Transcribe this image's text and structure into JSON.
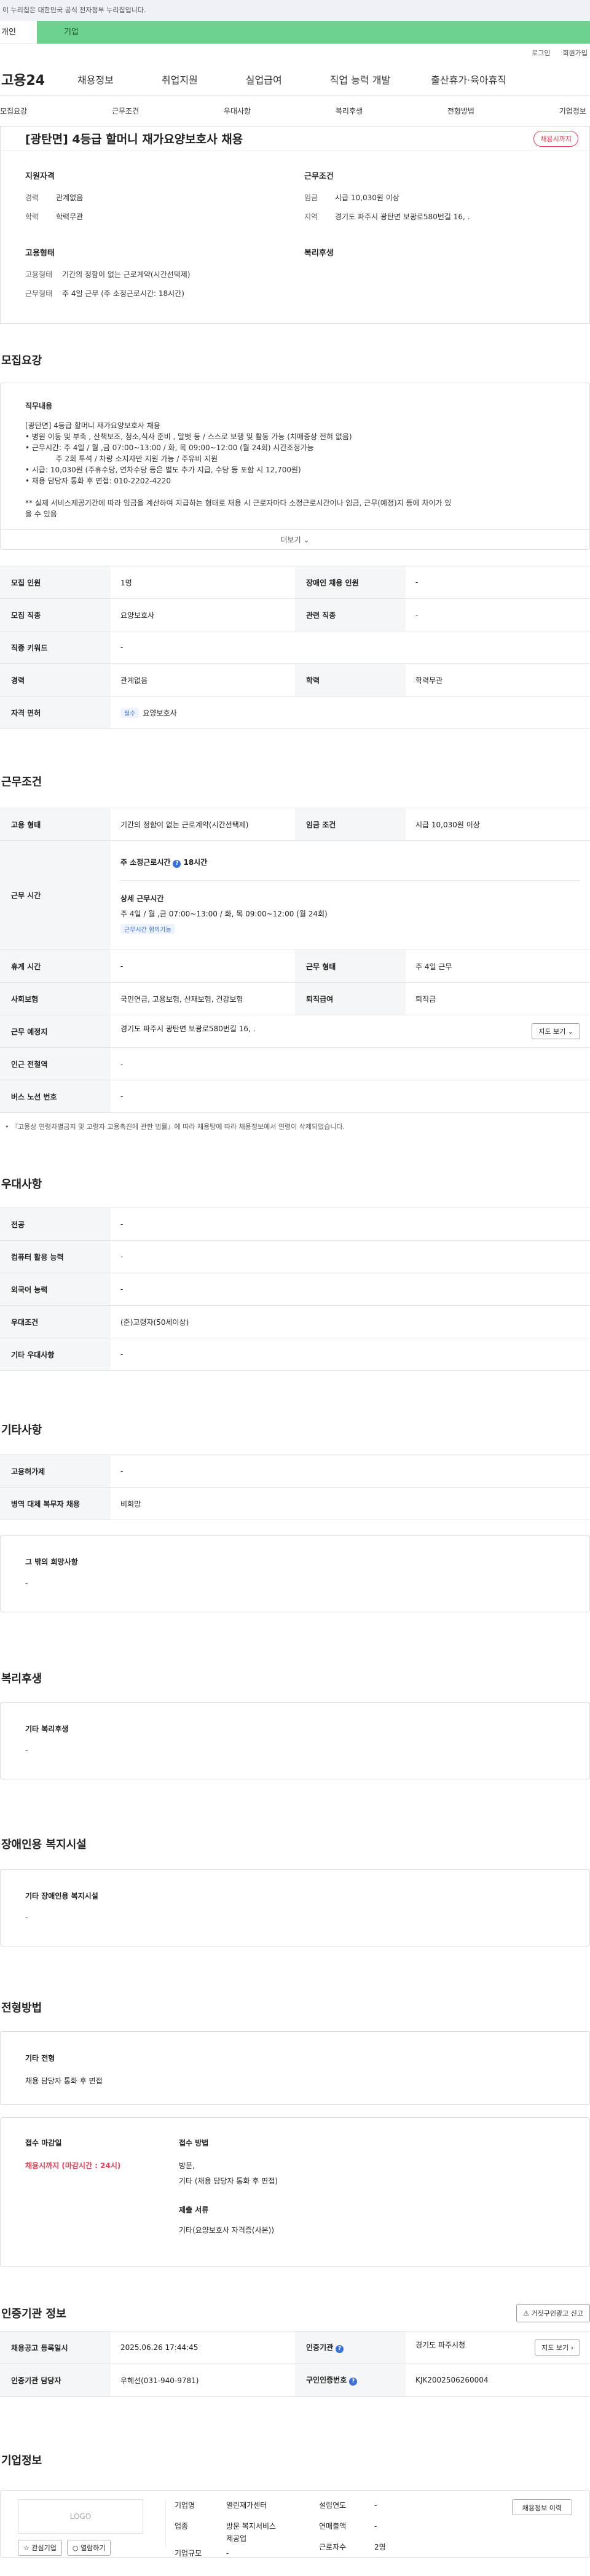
{
  "notice": "이 누리집은 대한민국 공식 전자정부 누리집입니다.",
  "topbar": {
    "tab_person": "개인",
    "tab_company": "기업"
  },
  "util": {
    "login": "로그인",
    "signup": "회원가입"
  },
  "gnb": {
    "logo": "고용24",
    "items": [
      "채용정보",
      "취업지원",
      "실업급여",
      "직업 능력 개발",
      "출산휴가·육아휴직"
    ]
  },
  "tabs": [
    "모집요강",
    "근무조건",
    "우대사항",
    "복리후생",
    "전형방법",
    "기업정보"
  ],
  "job": {
    "title": "[광탄면] 4등급 할머니 재가요양보호사 채용",
    "deadline": "채용시까지",
    "qualification": {
      "heading": "지원자격",
      "career_k": "경력",
      "career_v": "관계없음",
      "edu_k": "학력",
      "edu_v": "학력무관"
    },
    "condition": {
      "heading": "근무조건",
      "wage_k": "임금",
      "wage_v": "시급 10,030원 이상",
      "loc_k": "지역",
      "loc_v": "경기도 파주시 광탄면 보광로580번길 16, ."
    },
    "employment": {
      "heading": "고용형태",
      "type_k": "고용형태",
      "type_v": "기간의 정함이 없는 근로계약(시간선택제)",
      "hours_k": "근무형태",
      "hours_v": "주 4일 근무 (주 소정근로시간: 18시간)"
    },
    "welfare": {
      "heading": "복리후생"
    }
  },
  "recruit": {
    "section": "모집요강",
    "desc_label": "직무내용",
    "desc_lines": [
      "[광탄면] 4등급 할머니 재가요양보호사 채용",
      "• 병원 이동 및 부축 ,  산책보조, 청소,식사 준비 , 말벗  등 / 스스로 보행 및 활동 가능 (치매증상 전혀 없음)",
      "• 근무시간:  주 4일 / 월 ,금 07:00~13:00 / 화, 목 09:00~12:00 (월 24회)  시간조정가능",
      "             주 2회 투석 / 차량 소지자만 지원 가능 / 주유비 지원",
      "• 시급: 10,030원 (주휴수당, 연차수당 등은 별도 추가 지급, 수당 등 포함 시 12,700원)",
      "• 채용 담당자 통화 후 면접: 010-2202-4220",
      "",
      "** 실제 서비스제공기간에 따라 임금을 계산하여 지급하는 형태로 채용 시 근로자마다 소정근로시간이나 임금, 근무(예정)지 등에 차이가 있",
      "을 수 있음"
    ],
    "more": "더보기",
    "rows": [
      [
        "모집 인원",
        "1명",
        "장애인 채용 인원",
        "-"
      ],
      [
        "모집 직종",
        "요양보호사",
        "관련 직종",
        "-"
      ],
      [
        "직종 키워드",
        "-",
        "",
        ""
      ],
      [
        "경력",
        "관계없음",
        "학력",
        "학력무관"
      ]
    ],
    "license_k": "자격 면허",
    "license_chip": "필수",
    "license_v": "요양보호사"
  },
  "work": {
    "section": "근무조건",
    "type_k": "고용 형태",
    "type_v": "기간의 정함이 없는 근로계약(시간선택제)",
    "wage_k": "임금 조건",
    "wage_v": "시급 10,030원 이상",
    "time_k": "근무 시간",
    "weekly": "주 소정근로시간",
    "weekly_v": "18시간",
    "detail_h": "상세 근무시간",
    "detail_v": "주 4일 / 월 ,금 07:00~13:00 / 화, 목 09:00~12:00 (월 24회)",
    "adjust_chip": "근무시간 협의가능",
    "rest_k": "휴게 시간",
    "rest_v": "-",
    "form_k": "근무 형태",
    "form_v": "주 4일 근무",
    "ins_k": "사회보험",
    "ins_v": "국민연금, 고용보험, 산재보험, 건강보험",
    "sev_k": "퇴직급여",
    "sev_v": "퇴직금",
    "place_k": "근무 예정지",
    "place_v": "경기도 파주시 광탄면 보광로580번길 16, .",
    "map_btn": "지도 보기",
    "station_k": "인근 전철역",
    "station_v": "-",
    "bus_k": "버스 노선 번호",
    "bus_v": "-",
    "footnote": "• 『고용상 연령차별금지 및 고령자 고용촉진에 관한 법률』에 따라 채용탕에 따라 채용정보에서 연령이 삭제되었습니다."
  },
  "pref": {
    "section": "우대사항",
    "rows": [
      [
        "전공",
        "-"
      ],
      [
        "컴퓨터 활용 능력",
        "-"
      ],
      [
        "외국어 능력",
        "-"
      ],
      [
        "우대조건",
        "(준)고령자(50세이상)"
      ],
      [
        "기타 우대사항",
        "-"
      ]
    ]
  },
  "etc": {
    "section": "기타사항",
    "rows": [
      [
        "고용허가제",
        "-"
      ],
      [
        "병역 대체 복무자 채용",
        "비희망"
      ]
    ],
    "other_label": "그 밖의 희망사항",
    "other_v": "-"
  },
  "benefit": {
    "section": "복리후생",
    "label": "기타 복리후생",
    "value": "-"
  },
  "disabled": {
    "section": "장애인용 복지시설",
    "label": "기타 장애인용 복지시설",
    "value": "-"
  },
  "process": {
    "section": "전형방법",
    "label": "기타 전형",
    "value": "채용 담당자 통화 후 면접",
    "deadline_h": "접수 마감일",
    "deadline_v": "채용시까지 (마감시간 : 24시)",
    "method_h": "접수 방법",
    "method_v1": "방문,",
    "method_v2": "기타 (채용 담당자 통화 후 면접)",
    "docs_h": "제출 서류",
    "docs_v": "기타(요양보호사 자격증(사본))"
  },
  "agency": {
    "section": "인증기관 정보",
    "report": "거짓구인광고 신고",
    "reg_k": "채용공고 등록일시",
    "reg_v": "2025.06.26 17:44:45",
    "agency_k": "인증기관",
    "agency_v": "경기도 파주시청",
    "map_btn": "지도 보기",
    "manager_k": "인증기관 담당자",
    "manager_v": "우혜선(031-940-9781)",
    "num_k": "구인인증번호",
    "num_v": "KJK2002506260004"
  },
  "company": {
    "section": "기업정보",
    "logo": "LOGO",
    "interest": "관심기업",
    "favorite": "열람하기",
    "name_k": "기업명",
    "name_v": "열린재가센터",
    "ind_k": "업종",
    "ind_v1": "방문 복지서비스",
    "ind_v2": "제공업",
    "size_k": "기업규모",
    "size_v": "-",
    "found_k": "설립연도",
    "found_v": "-",
    "rev_k": "연매출액",
    "rev_v": "-",
    "emp_k": "근로자수",
    "emp_v": "2명",
    "history_btn": "채용정보 이력"
  }
}
